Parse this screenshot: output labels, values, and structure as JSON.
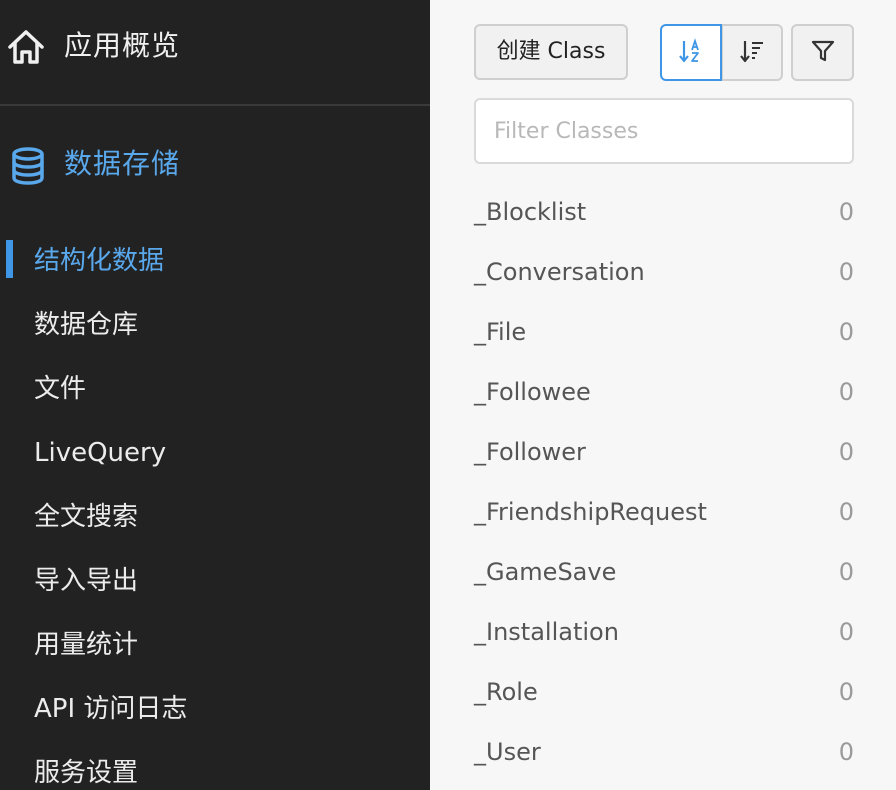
{
  "sidebar": {
    "overview_label": "应用概览",
    "storage_label": "数据存储",
    "items": [
      {
        "label": "结构化数据",
        "active": true
      },
      {
        "label": "数据仓库"
      },
      {
        "label": "文件"
      },
      {
        "label": "LiveQuery"
      },
      {
        "label": "全文搜索"
      },
      {
        "label": "导入导出"
      },
      {
        "label": "用量统计"
      },
      {
        "label": "API 访问日志"
      },
      {
        "label": "服务设置"
      }
    ]
  },
  "toolbar": {
    "create_label": "创建 Class",
    "sort_az_icon": "sort-alpha-icon",
    "sort_desc_icon": "sort-desc-icon",
    "filter_icon": "filter-funnel-icon"
  },
  "search": {
    "placeholder": "Filter Classes",
    "value": ""
  },
  "classes": [
    {
      "name": "_Blocklist",
      "count": "0"
    },
    {
      "name": "_Conversation",
      "count": "0"
    },
    {
      "name": "_File",
      "count": "0"
    },
    {
      "name": "_Followee",
      "count": "0"
    },
    {
      "name": "_Follower",
      "count": "0"
    },
    {
      "name": "_FriendshipRequest",
      "count": "0"
    },
    {
      "name": "_GameSave",
      "count": "0"
    },
    {
      "name": "_Installation",
      "count": "0"
    },
    {
      "name": "_Role",
      "count": "0"
    },
    {
      "name": "_User",
      "count": "0"
    }
  ],
  "colors": {
    "sidebar_bg": "#222222",
    "accent": "#3f95e6",
    "accent_text": "#5aa8ec"
  }
}
